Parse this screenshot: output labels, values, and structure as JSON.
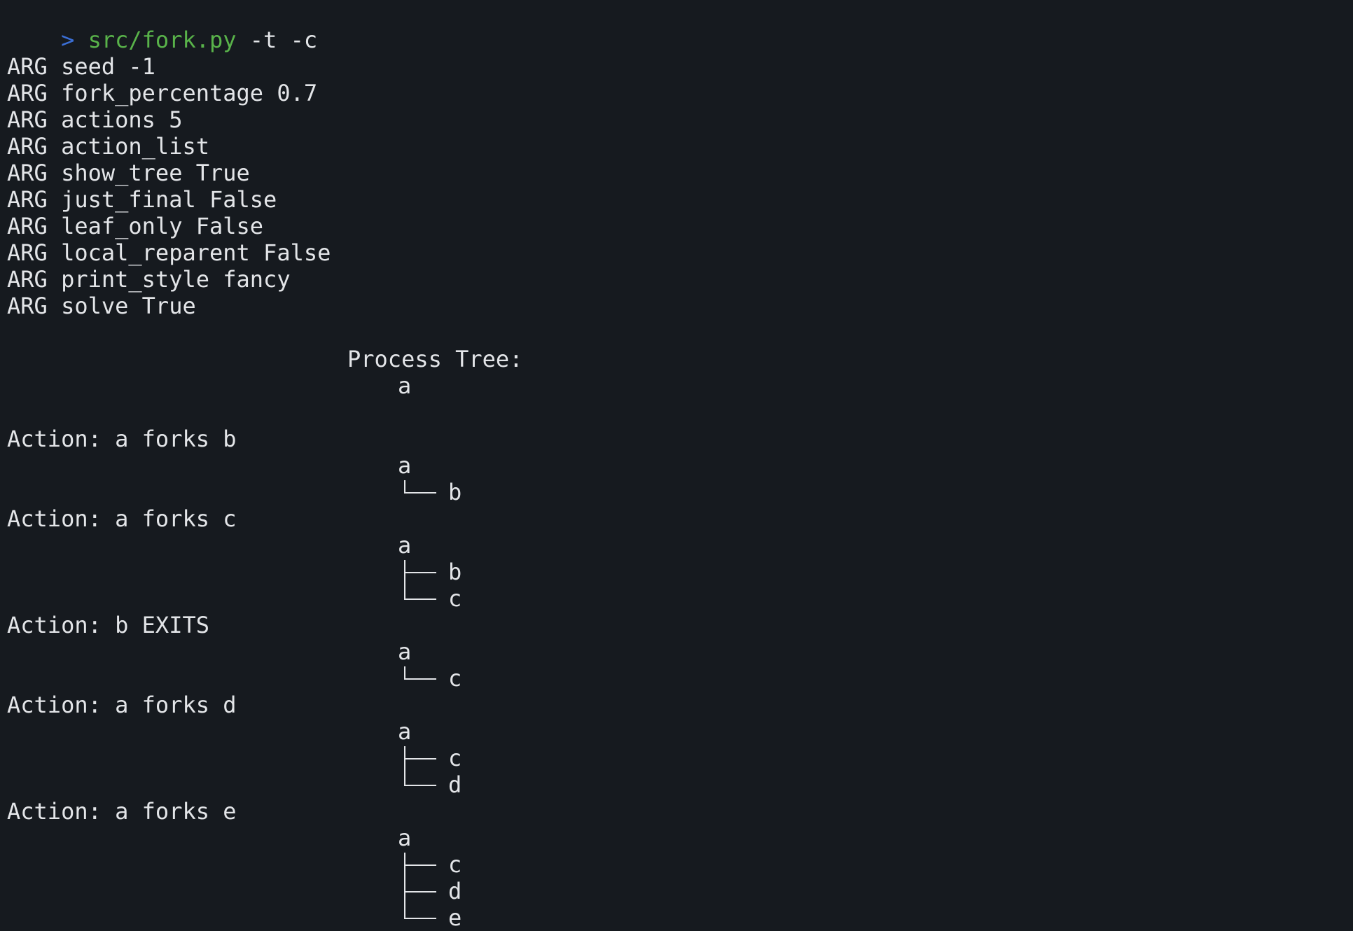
{
  "terminal": {
    "prompt": {
      "arrow": ">",
      "path": "src/fork.py",
      "args": "-t -c"
    },
    "arg_lines": [
      "ARG seed -1",
      "ARG fork_percentage 0.7",
      "ARG actions 5",
      "ARG action_list",
      "ARG show_tree True",
      "ARG just_final False",
      "ARG leaf_only False",
      "ARG local_reparent False",
      "ARG print_style fancy",
      "ARG solve True"
    ],
    "tree_header": "Process Tree:",
    "initial_root": "a",
    "actions": [
      {
        "text": "Action: a forks b",
        "root": "a",
        "children": [
          "b"
        ]
      },
      {
        "text": "Action: a forks c",
        "root": "a",
        "children": [
          "b",
          "c"
        ]
      },
      {
        "text": "Action: b EXITS",
        "root": "a",
        "children": [
          "c"
        ]
      },
      {
        "text": "Action: a forks d",
        "root": "a",
        "children": [
          "c",
          "d"
        ]
      },
      {
        "text": "Action: a forks e",
        "root": "a",
        "children": [
          "c",
          "d",
          "e"
        ]
      }
    ]
  }
}
